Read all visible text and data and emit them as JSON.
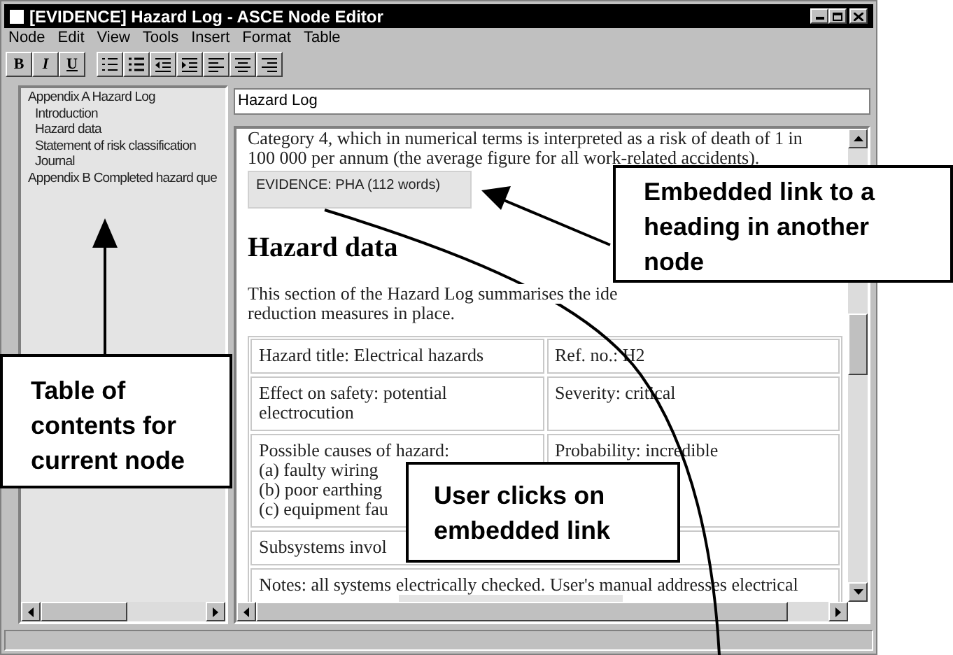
{
  "window": {
    "title": "[EVIDENCE] Hazard Log - ASCE Node Editor"
  },
  "menu": [
    "Node",
    "Edit",
    "View",
    "Tools",
    "Insert",
    "Format",
    "Table"
  ],
  "toolbar": [
    {
      "kind": "bold",
      "label": "B"
    },
    {
      "kind": "italic",
      "label": "I"
    },
    {
      "kind": "underline",
      "label": "U"
    },
    {
      "kind": "numbered-list"
    },
    {
      "kind": "bullet-list"
    },
    {
      "kind": "outdent"
    },
    {
      "kind": "indent"
    },
    {
      "kind": "align-left"
    },
    {
      "kind": "align-center"
    },
    {
      "kind": "align-right"
    }
  ],
  "toc": [
    {
      "label": "Appendix A Hazard Log",
      "children": [
        {
          "label": "Introduction"
        },
        {
          "label": "Hazard data"
        },
        {
          "label": "Statement of risk classification"
        },
        {
          "label": "Journal"
        }
      ]
    },
    {
      "label": "Appendix B Completed hazard que"
    }
  ],
  "title_field": {
    "value": "Hazard Log"
  },
  "document": {
    "intro_lines": [
      "Category 4, which in numerical terms is interpreted as a risk of death of 1 in",
      "100 000 per annum (the average figure for all work-related accidents)."
    ],
    "evidence_link": "EVIDENCE: PHA (112 words)",
    "heading": "Hazard data",
    "paragraph_lines": [
      "This section of the Hazard Log summarises the ide",
      "reduction measures in place."
    ],
    "table": [
      {
        "cells": [
          {
            "lines": [
              "Hazard title: Electrical hazards"
            ]
          },
          {
            "lines": [
              "Ref. no.: H2"
            ]
          }
        ]
      },
      {
        "cells": [
          {
            "lines": [
              "Effect on safety: potential",
              "electrocution"
            ]
          },
          {
            "lines": [
              "Severity: critical"
            ]
          }
        ]
      },
      {
        "cells": [
          {
            "lines": [
              "Possible causes of hazard:",
              "(a) faulty wiring",
              "(b) poor earthing",
              "(c) equipment fau"
            ]
          },
          {
            "lines": [
              "Probability: incredible"
            ]
          }
        ]
      },
      {
        "cells": [
          {
            "lines": [
              "Subsystems invol"
            ]
          }
        ]
      },
      {
        "cells": [
          {
            "lines": [
              "Notes: all systems electrically checked. User's manual addresses electrical"
            ]
          }
        ]
      }
    ]
  },
  "annotations": [
    {
      "text": "Embedded link to a heading in another node"
    },
    {
      "text": "Table of contents for current node"
    },
    {
      "text": "User clicks on embedded link"
    }
  ]
}
